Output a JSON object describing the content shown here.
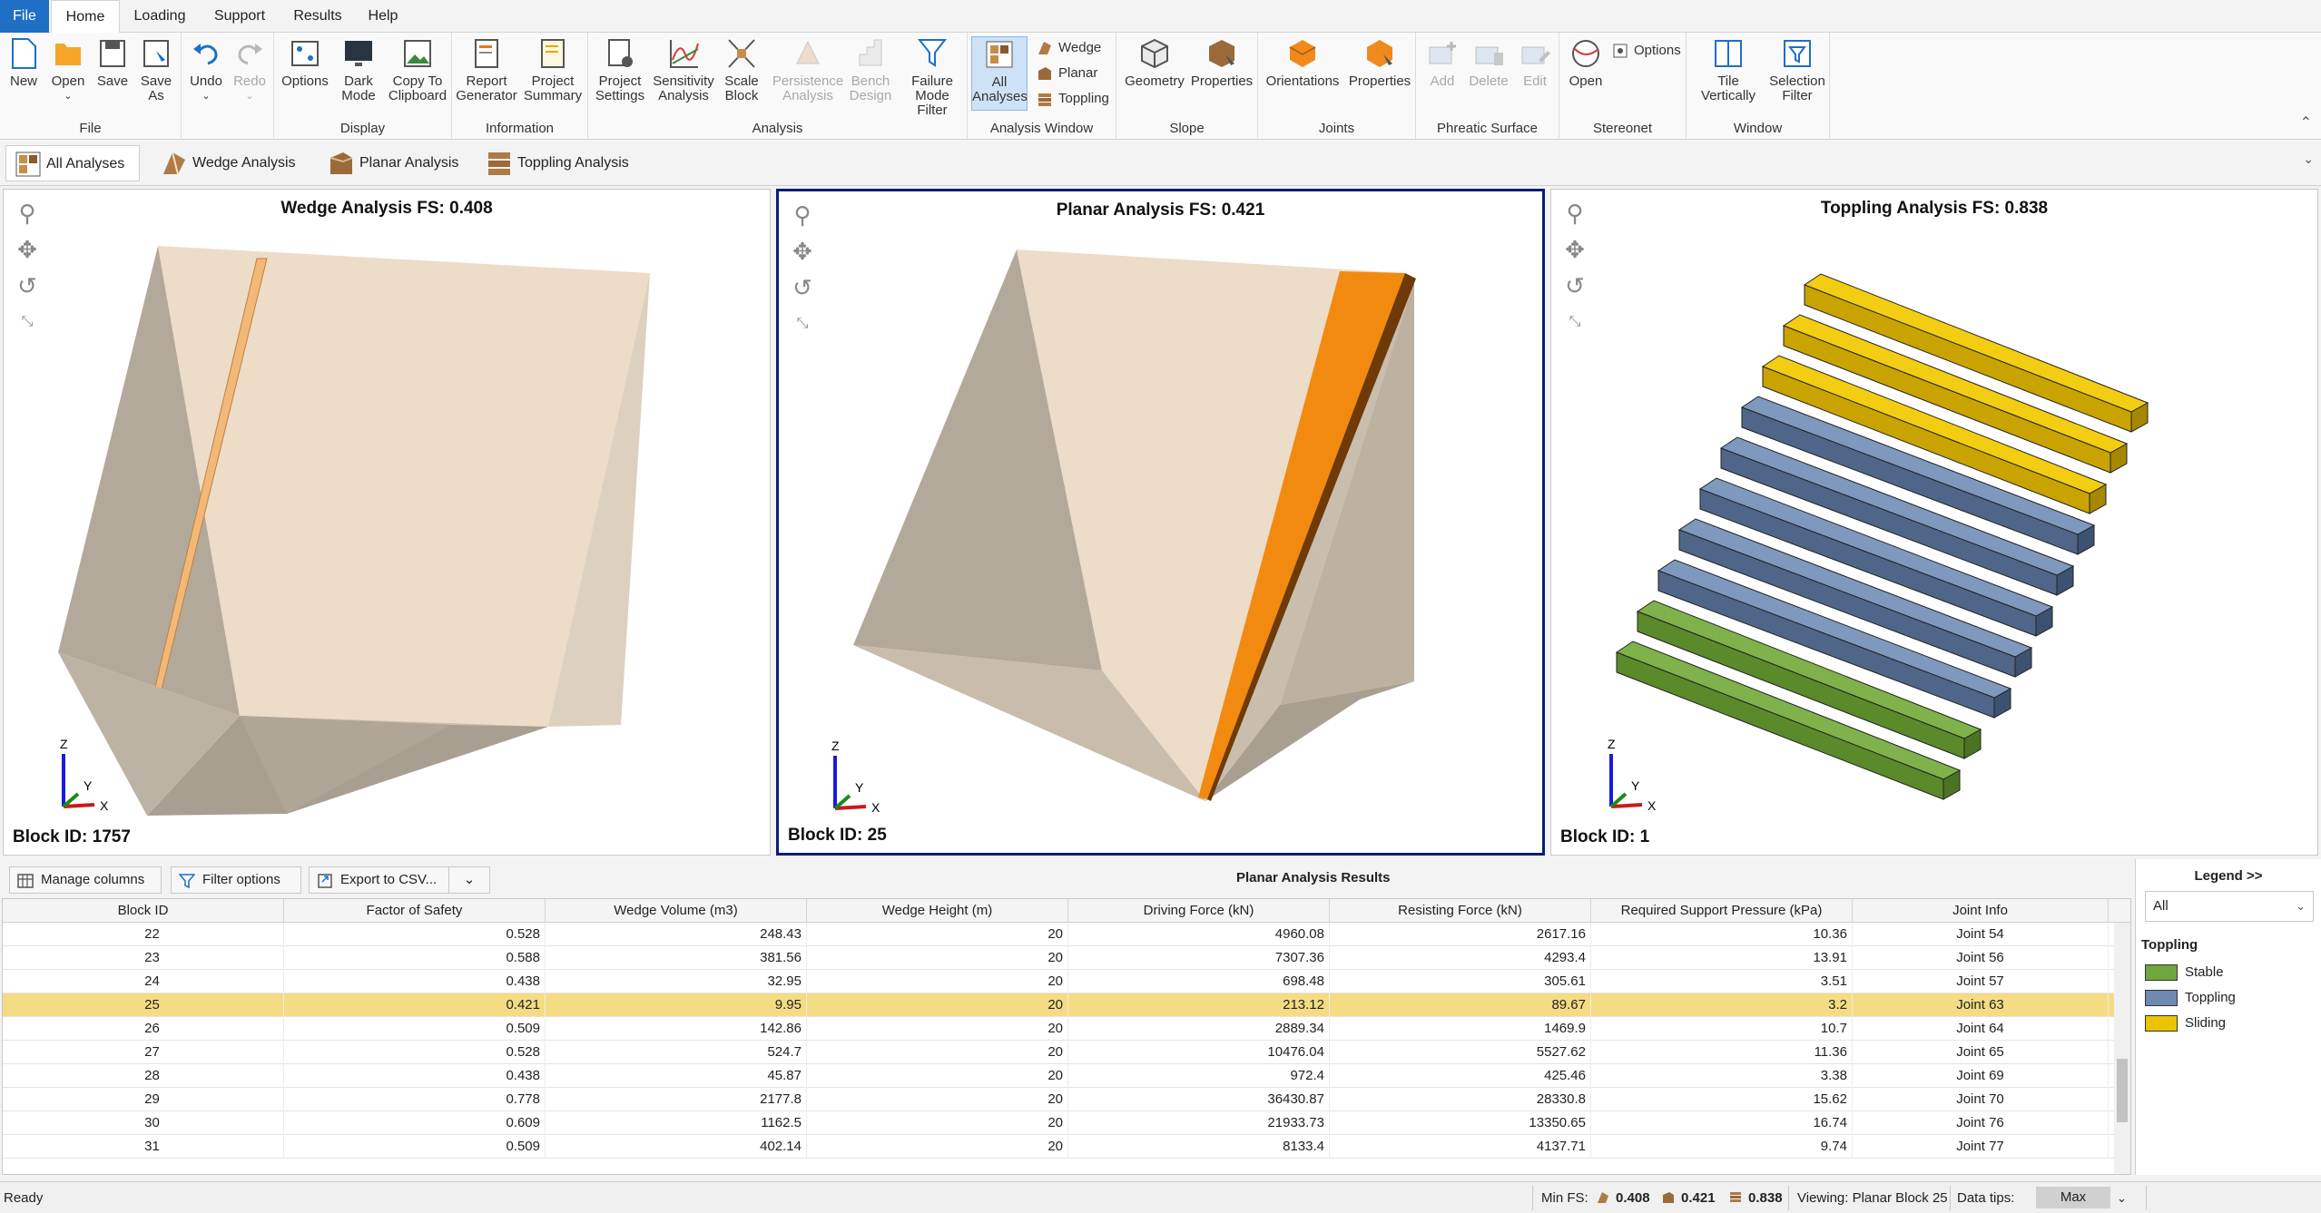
{
  "menu": {
    "tabs": [
      "File",
      "Home",
      "Loading",
      "Support",
      "Results",
      "Help"
    ]
  },
  "ribbon": {
    "groups": {
      "file": "File",
      "display": "Display",
      "information": "Information",
      "analysis": "Analysis",
      "analysis_window": "Analysis Window",
      "slope": "Slope",
      "joints": "Joints",
      "phreatic": "Phreatic Surface",
      "stereonet": "Stereonet",
      "window": "Window"
    },
    "buttons": {
      "new": "New",
      "open": "Open",
      "save": "Save",
      "save_as": "Save As",
      "undo": "Undo",
      "redo": "Redo",
      "options": "Options",
      "dark_mode": "Dark Mode",
      "copy": "Copy To Clipboard",
      "report": "Report Generator",
      "summary": "Project Summary",
      "project_settings": "Project Settings",
      "sensitivity": "Sensitivity Analysis",
      "scale_block": "Scale Block",
      "persistence": "Persistence Analysis",
      "bench": "Bench Design",
      "failure_filter": "Failure Mode Filter",
      "all_analyses": "All Analyses",
      "wedge": "Wedge",
      "planar": "Planar",
      "toppling": "Toppling",
      "geometry": "Geometry",
      "slope_properties": "Properties",
      "orientations": "Orientations",
      "joint_properties": "Properties",
      "add": "Add",
      "delete": "Delete",
      "edit": "Edit",
      "stereo_open": "Open",
      "stereo_options": "Options",
      "tile": "Tile Vertically",
      "selection_filter": "Selection Filter"
    }
  },
  "analysis_tabs": [
    "All Analyses",
    "Wedge Analysis",
    "Planar Analysis",
    "Toppling Analysis"
  ],
  "viewports": [
    {
      "title": "Wedge Analysis FS: 0.408",
      "block": "Block ID: 1757"
    },
    {
      "title": "Planar Analysis FS: 0.421",
      "block": "Block ID: 25"
    },
    {
      "title": "Toppling Analysis FS: 0.838",
      "block": "Block ID: 1"
    }
  ],
  "axes": {
    "z": "Z",
    "y": "Y",
    "x": "X"
  },
  "results": {
    "toolbar": {
      "manage": "Manage columns",
      "filter": "Filter options",
      "export": "Export to CSV..."
    },
    "title": "Planar Analysis Results",
    "columns": [
      "Block ID",
      "Factor of Safety",
      "Wedge Volume (m3)",
      "Wedge Height (m)",
      "Driving Force (kN)",
      "Resisting Force (kN)",
      "Required Support Pressure (kPa)",
      "Joint Info"
    ],
    "rows": [
      [
        "22",
        "0.528",
        "248.43",
        "20",
        "4960.08",
        "2617.16",
        "10.36",
        "Joint 54"
      ],
      [
        "23",
        "0.588",
        "381.56",
        "20",
        "7307.36",
        "4293.4",
        "13.91",
        "Joint 56"
      ],
      [
        "24",
        "0.438",
        "32.95",
        "20",
        "698.48",
        "305.61",
        "3.51",
        "Joint 57"
      ],
      [
        "25",
        "0.421",
        "9.95",
        "20",
        "213.12",
        "89.67",
        "3.2",
        "Joint 63"
      ],
      [
        "26",
        "0.509",
        "142.86",
        "20",
        "2889.34",
        "1469.9",
        "10.7",
        "Joint 64"
      ],
      [
        "27",
        "0.528",
        "524.7",
        "20",
        "10476.04",
        "5527.62",
        "11.36",
        "Joint 65"
      ],
      [
        "28",
        "0.438",
        "45.87",
        "20",
        "972.4",
        "425.46",
        "3.38",
        "Joint 69"
      ],
      [
        "29",
        "0.778",
        "2177.8",
        "20",
        "36430.87",
        "28330.8",
        "15.62",
        "Joint 70"
      ],
      [
        "30",
        "0.609",
        "1162.5",
        "20",
        "21933.73",
        "13350.65",
        "16.74",
        "Joint 76"
      ],
      [
        "31",
        "0.509",
        "402.14",
        "20",
        "8133.4",
        "4137.71",
        "9.74",
        "Joint 77"
      ]
    ],
    "selected_block": "25"
  },
  "legend": {
    "title": "Legend >>",
    "filter": "All",
    "section": "Toppling",
    "items": [
      {
        "label": "Stable",
        "color": "#6fa73e"
      },
      {
        "label": "Toppling",
        "color": "#6e89b2"
      },
      {
        "label": "Sliding",
        "color": "#ebc300"
      }
    ]
  },
  "status": {
    "ready": "Ready",
    "min_fs": "Min FS:",
    "fs_wedge": "0.408",
    "fs_planar": "0.421",
    "fs_toppling": "0.838",
    "viewing": "Viewing: Planar Block 25",
    "data_tips": "Data tips:",
    "max": "Max"
  }
}
